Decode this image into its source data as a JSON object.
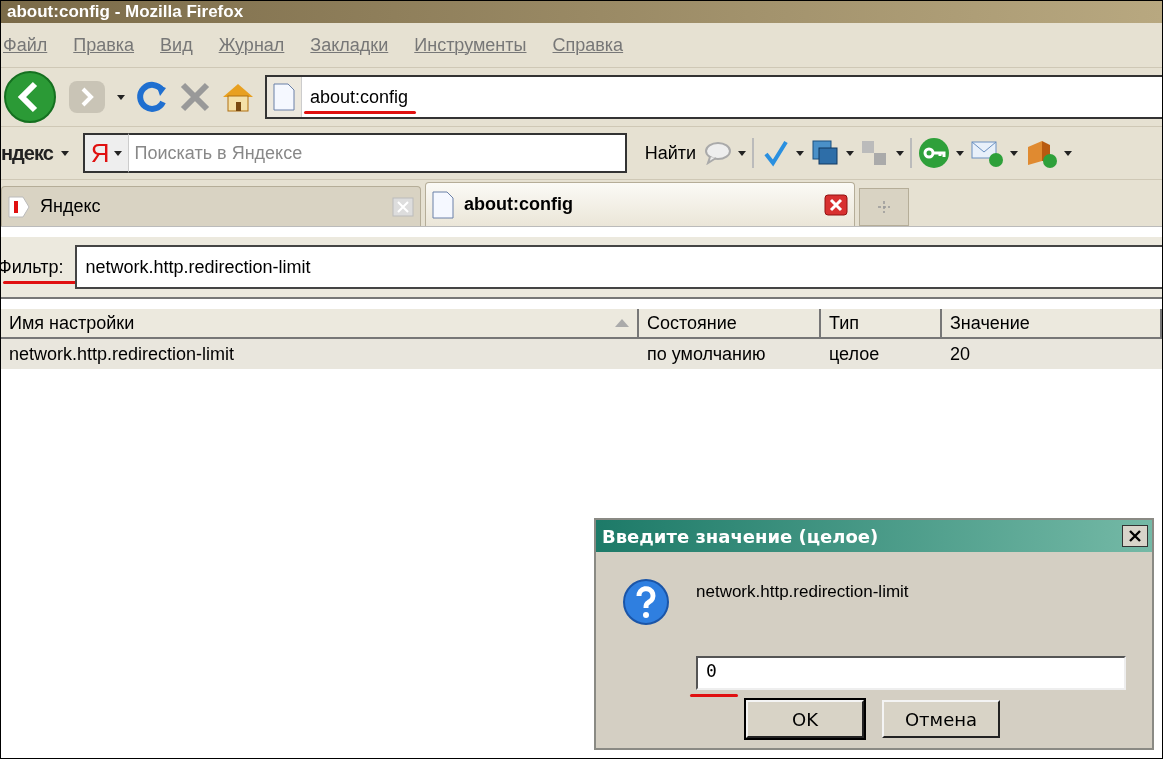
{
  "window": {
    "title": "about:config - Mozilla Firefox"
  },
  "menu": [
    "Файл",
    "Правка",
    "Вид",
    "Журнал",
    "Закладки",
    "Инструменты",
    "Справка"
  ],
  "navbar": {
    "address": "about:config"
  },
  "yandex_bar": {
    "label": "ндекс",
    "logo": "Я",
    "placeholder": "Поискать в Яндексе",
    "find_button": "Найти"
  },
  "tabs": [
    {
      "label": "Яндекс",
      "selected": false
    },
    {
      "label": "about:config",
      "selected": true
    }
  ],
  "filter": {
    "label": "Фильтр:",
    "value": "network.http.redirection-limit"
  },
  "table": {
    "columns": [
      "Имя настройки",
      "Состояние",
      "Тип",
      "Значение"
    ],
    "rows": [
      [
        "network.http.redirection-limit",
        "по умолчанию",
        "целое",
        "20"
      ]
    ]
  },
  "dialog": {
    "title": "Введите значение (целое)",
    "message": "network.http.redirection-limit",
    "value": "0",
    "buttons": [
      "OK",
      "Отмена"
    ]
  }
}
